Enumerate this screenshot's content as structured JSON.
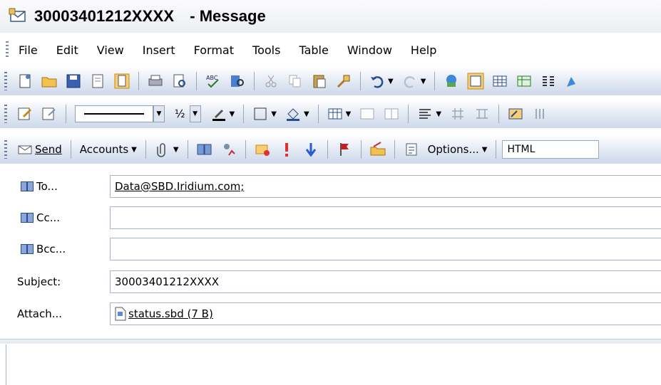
{
  "window": {
    "title": "30003401212XXXX",
    "title_suffix": "- Message"
  },
  "menu": [
    {
      "label": "File"
    },
    {
      "label": "Edit"
    },
    {
      "label": "View"
    },
    {
      "label": "Insert"
    },
    {
      "label": "Format"
    },
    {
      "label": "Tools"
    },
    {
      "label": "Table"
    },
    {
      "label": "Window"
    },
    {
      "label": "Help"
    }
  ],
  "toolbar2": {
    "fraction": "½"
  },
  "toolbar3": {
    "send_label": "Send",
    "accounts_label": "Accounts",
    "options_label": "Options...",
    "format_value": "HTML"
  },
  "fields": {
    "to_label": "To...",
    "to_value": "Data@SBD.Iridium.com;",
    "cc_label": "Cc...",
    "cc_value": "",
    "bcc_label": "Bcc...",
    "bcc_value": "",
    "subject_label": "Subject:",
    "subject_value": "30003401212XXXX",
    "attach_label": "Attach...",
    "attachment_name": "status.sbd (7 B)"
  },
  "icons": {
    "title": "message-icon",
    "address_book": "address-book-icon",
    "attachment": "file-icon"
  }
}
